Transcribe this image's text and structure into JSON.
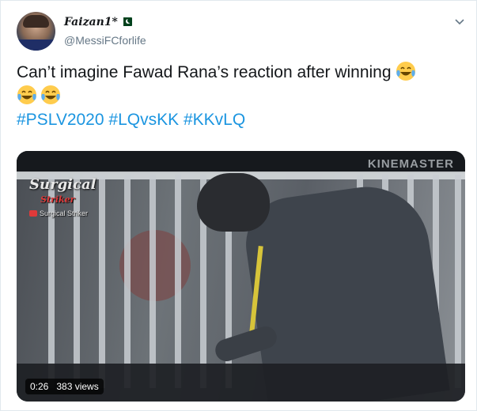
{
  "author": {
    "display_name": "Faizan1*",
    "handle": "@MessiFCforlife"
  },
  "tweet": {
    "text": "Can’t imagine Fawad Rana’s reaction after winning",
    "emoji": "face-with-tears-of-joy",
    "hashtags": [
      "#PSLV2020",
      "#LQvsKK",
      "#KKvLQ"
    ]
  },
  "media": {
    "watermark_title": "Surgical",
    "watermark_subtitle": "Striker",
    "watermark_channel": "Surgical Striker",
    "editor_watermark": "KINEMASTER",
    "duration": "0:26",
    "views": "383 views"
  },
  "icons": {
    "caret": "chevron-down-icon",
    "flag": "pakistan-flag-icon"
  },
  "colors": {
    "hashtag": "#1b95e0",
    "secondary_text": "#657786",
    "border": "#e1e8ed"
  }
}
